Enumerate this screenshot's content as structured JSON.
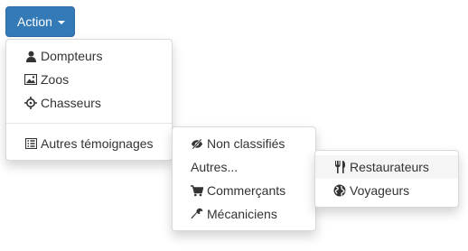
{
  "action_button": {
    "label": "Action"
  },
  "menu": {
    "items": [
      {
        "label": "Dompteurs",
        "icon": "user-icon"
      },
      {
        "label": "Zoos",
        "icon": "picture-icon"
      },
      {
        "label": "Chasseurs",
        "icon": "screenshot-icon"
      }
    ],
    "submenu_trigger": {
      "label": "Autres témoignages",
      "icon": "list-alt-icon"
    }
  },
  "submenu": {
    "items": [
      {
        "label": "Non classifiés",
        "icon": "eye-slash-icon"
      },
      {
        "label": "Autres...",
        "icon": ""
      },
      {
        "label": "Commerçants",
        "icon": "shopping-cart-icon"
      },
      {
        "label": "Mécaniciens",
        "icon": "wrench-icon"
      }
    ]
  },
  "subsubmenu": {
    "items": [
      {
        "label": "Restaurateurs",
        "icon": "cutlery-icon"
      },
      {
        "label": "Voyageurs",
        "icon": "globe-icon"
      }
    ]
  },
  "colors": {
    "primary": "#337ab7",
    "text": "#333333",
    "hover": "#f5f5f5"
  }
}
